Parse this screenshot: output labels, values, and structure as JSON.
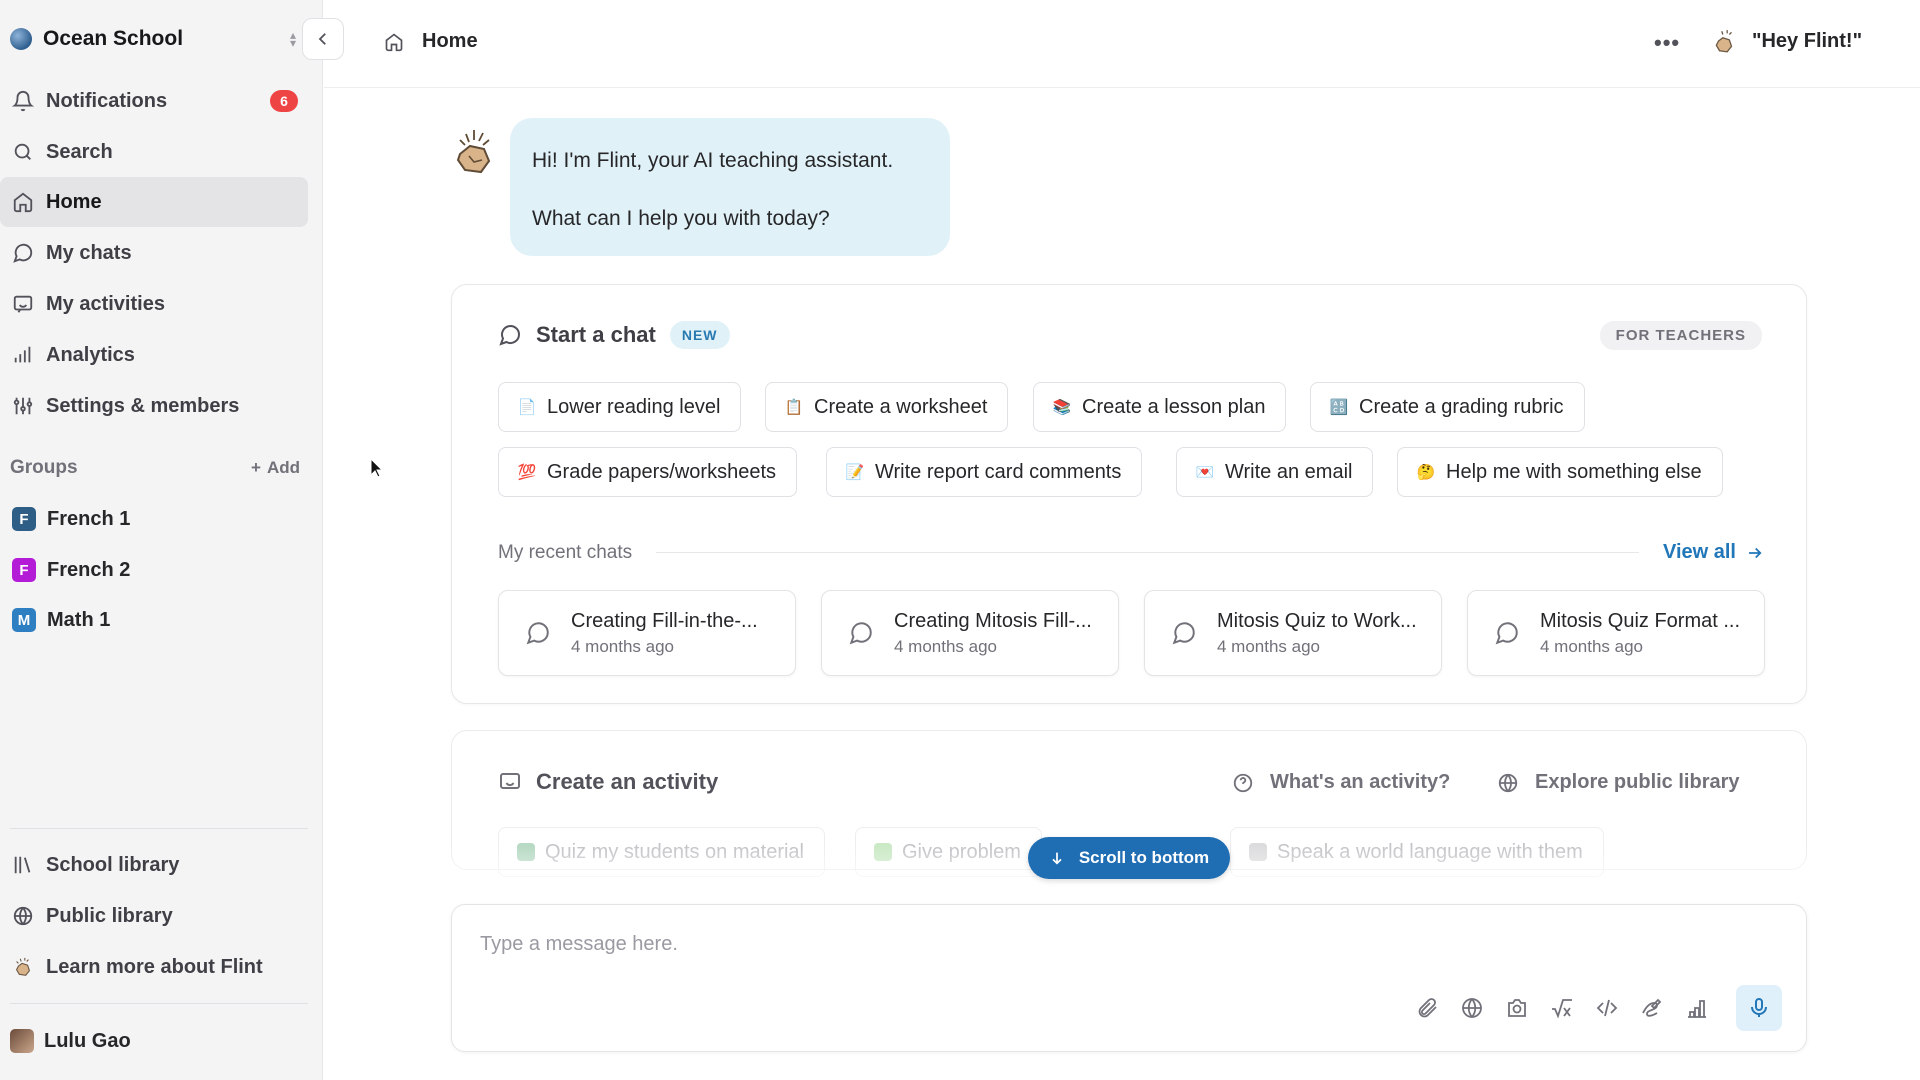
{
  "workspace": {
    "name": "Ocean School"
  },
  "sidebar": {
    "notifications": {
      "label": "Notifications",
      "count": "6"
    },
    "items": [
      {
        "label": "Search",
        "icon": "search-icon"
      },
      {
        "label": "Home",
        "icon": "home-icon",
        "active": true
      },
      {
        "label": "My chats",
        "icon": "chat-icon"
      },
      {
        "label": "My activities",
        "icon": "activity-icon"
      },
      {
        "label": "Analytics",
        "icon": "analytics-icon"
      },
      {
        "label": "Settings & members",
        "icon": "settings-icon"
      }
    ],
    "groups_label": "Groups",
    "groups_add": "Add",
    "groups": [
      {
        "initial": "F",
        "label": "French 1",
        "color": "#2e5e86"
      },
      {
        "initial": "F",
        "label": "French 2",
        "color": "#b41bd6"
      },
      {
        "initial": "M",
        "label": "Math 1",
        "color": "#2e7fc2"
      }
    ],
    "bottom_items": [
      {
        "label": "School library",
        "icon": "library-icon"
      },
      {
        "label": "Public library",
        "icon": "globe-icon"
      },
      {
        "label": "Learn more about Flint",
        "icon": "flint-icon"
      }
    ],
    "user": {
      "name": "Lulu Gao"
    }
  },
  "topbar": {
    "breadcrumb": "Home",
    "more": "•••",
    "hey_flint": "\"Hey Flint!\""
  },
  "greeting": {
    "line1": "Hi! I'm Flint, your AI teaching assistant.",
    "line2": "What can I help you with today?"
  },
  "start_chat": {
    "title": "Start a chat",
    "new_badge": "NEW",
    "audience": "FOR TEACHERS",
    "chips": [
      {
        "label": "Lower reading level",
        "emoji": "📄"
      },
      {
        "label": "Create a worksheet",
        "emoji": "📋"
      },
      {
        "label": "Create a lesson plan",
        "emoji": "📚"
      },
      {
        "label": "Create a grading rubric",
        "emoji": "🔠"
      },
      {
        "label": "Grade papers/worksheets",
        "emoji": "💯"
      },
      {
        "label": "Write report card comments",
        "emoji": "📝"
      },
      {
        "label": "Write an email",
        "emoji": "💌"
      },
      {
        "label": "Help me with something else",
        "emoji": "🤔"
      }
    ],
    "recent_label": "My recent chats",
    "view_all": "View all",
    "recent_chats": [
      {
        "title": "Creating Fill-in-the-...",
        "time": "4 months ago"
      },
      {
        "title": "Creating Mitosis Fill-...",
        "time": "4 months ago"
      },
      {
        "title": "Mitosis Quiz to Work...",
        "time": "4 months ago"
      },
      {
        "title": "Mitosis Quiz Format ...",
        "time": "4 months ago"
      }
    ]
  },
  "activity": {
    "title": "Create an activity",
    "whats_activity": "What's an activity?",
    "explore": "Explore public library",
    "chips": [
      {
        "label": "Quiz my students on material"
      },
      {
        "label": "Give problem"
      },
      {
        "label": "Speak a world language with them"
      }
    ]
  },
  "scroll_button": "Scroll to bottom",
  "composer": {
    "placeholder": "Type a message here.",
    "tools": [
      "attach-icon",
      "web-icon",
      "camera-icon",
      "math-icon",
      "code-icon",
      "draw-icon",
      "chart-icon",
      "mic-icon"
    ]
  },
  "colors": {
    "accent": "#1f6db3",
    "bubble": "#e0f2f8",
    "badge": "#ef4444"
  }
}
